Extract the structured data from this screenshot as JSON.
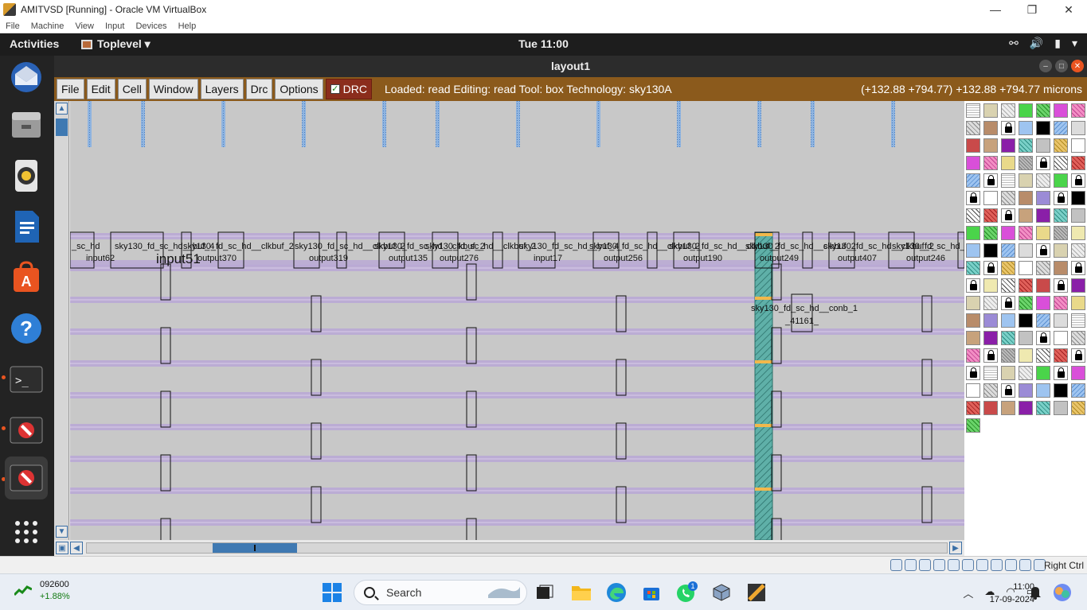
{
  "host_window": {
    "title": "AMITVSD [Running] - Oracle VM VirtualBox",
    "controls": {
      "minimize": "—",
      "restore": "❐",
      "close": "✕"
    },
    "menu": [
      "File",
      "Machine",
      "View",
      "Input",
      "Devices",
      "Help"
    ]
  },
  "ubuntu_topbar": {
    "activities": "Activities",
    "app_menu": "Toplevel ▾",
    "clock": "Tue 11:00"
  },
  "magic_window": {
    "title": "layout1",
    "menu": [
      "File",
      "Edit",
      "Cell",
      "Window",
      "Layers",
      "Drc",
      "Options"
    ],
    "drc_label": "DRC",
    "drc_checked": true,
    "status": "Loaded: read Editing: read Tool: box  Technology: sky130A",
    "coordinates": "(+132.88 +794.77) +132.88 +794.77 microns"
  },
  "layout": {
    "cells": [
      {
        "name": "_sc_hd",
        "inst": "input62"
      },
      {
        "name": "sky130_fd_sc_hd__buf_4",
        "inst": "input51"
      },
      {
        "name": "sky130_fd_sc_hd__clkbuf_2",
        "inst": "output370"
      },
      {
        "name": "sky130_fd_sc_hd__clkbuf_2",
        "inst": "output319"
      },
      {
        "name": "sky130_fd_sc_hd__clkbuf_2",
        "inst": "output135"
      },
      {
        "name": "sky130_fd_sc_hd__clkbuf_2",
        "inst": "output276"
      },
      {
        "name": "sky130_fd_sc_hd__buf_4",
        "inst": "input17"
      },
      {
        "name": "sky130_fd_sc_hd__clkbuf_2",
        "inst": "output256"
      },
      {
        "name": "sky130_fd_sc_hd__clkbuf_2",
        "inst": "output190"
      },
      {
        "name": "sky130_fd_sc_hd__clkbuf_2",
        "inst": "output249"
      },
      {
        "name": "sky130_fd_sc_hd__clkbuf_2",
        "inst": "output407"
      },
      {
        "name": "sky130_fd_sc_hd__clkbuf_2",
        "inst": "output246"
      }
    ],
    "conb_cell": {
      "name": "sky130_fd_sc_hd__conb_1",
      "inst": "_41161_"
    },
    "colors": {
      "background": "#c6c6c6",
      "rail": "#b9a7d6",
      "pin": "#8fb4e0",
      "highlight": "#5fb0a8",
      "label_box": "#f2b84b"
    }
  },
  "palette": {
    "rows": 19,
    "cols": 7
  },
  "vb_status": {
    "host_key": "Right Ctrl"
  },
  "taskbar": {
    "stock_symbol": "092600",
    "stock_change": "+1.88%",
    "search_label": "Search",
    "whatsapp_badge": "1",
    "time": "11:00",
    "date": "17-09-2024"
  }
}
